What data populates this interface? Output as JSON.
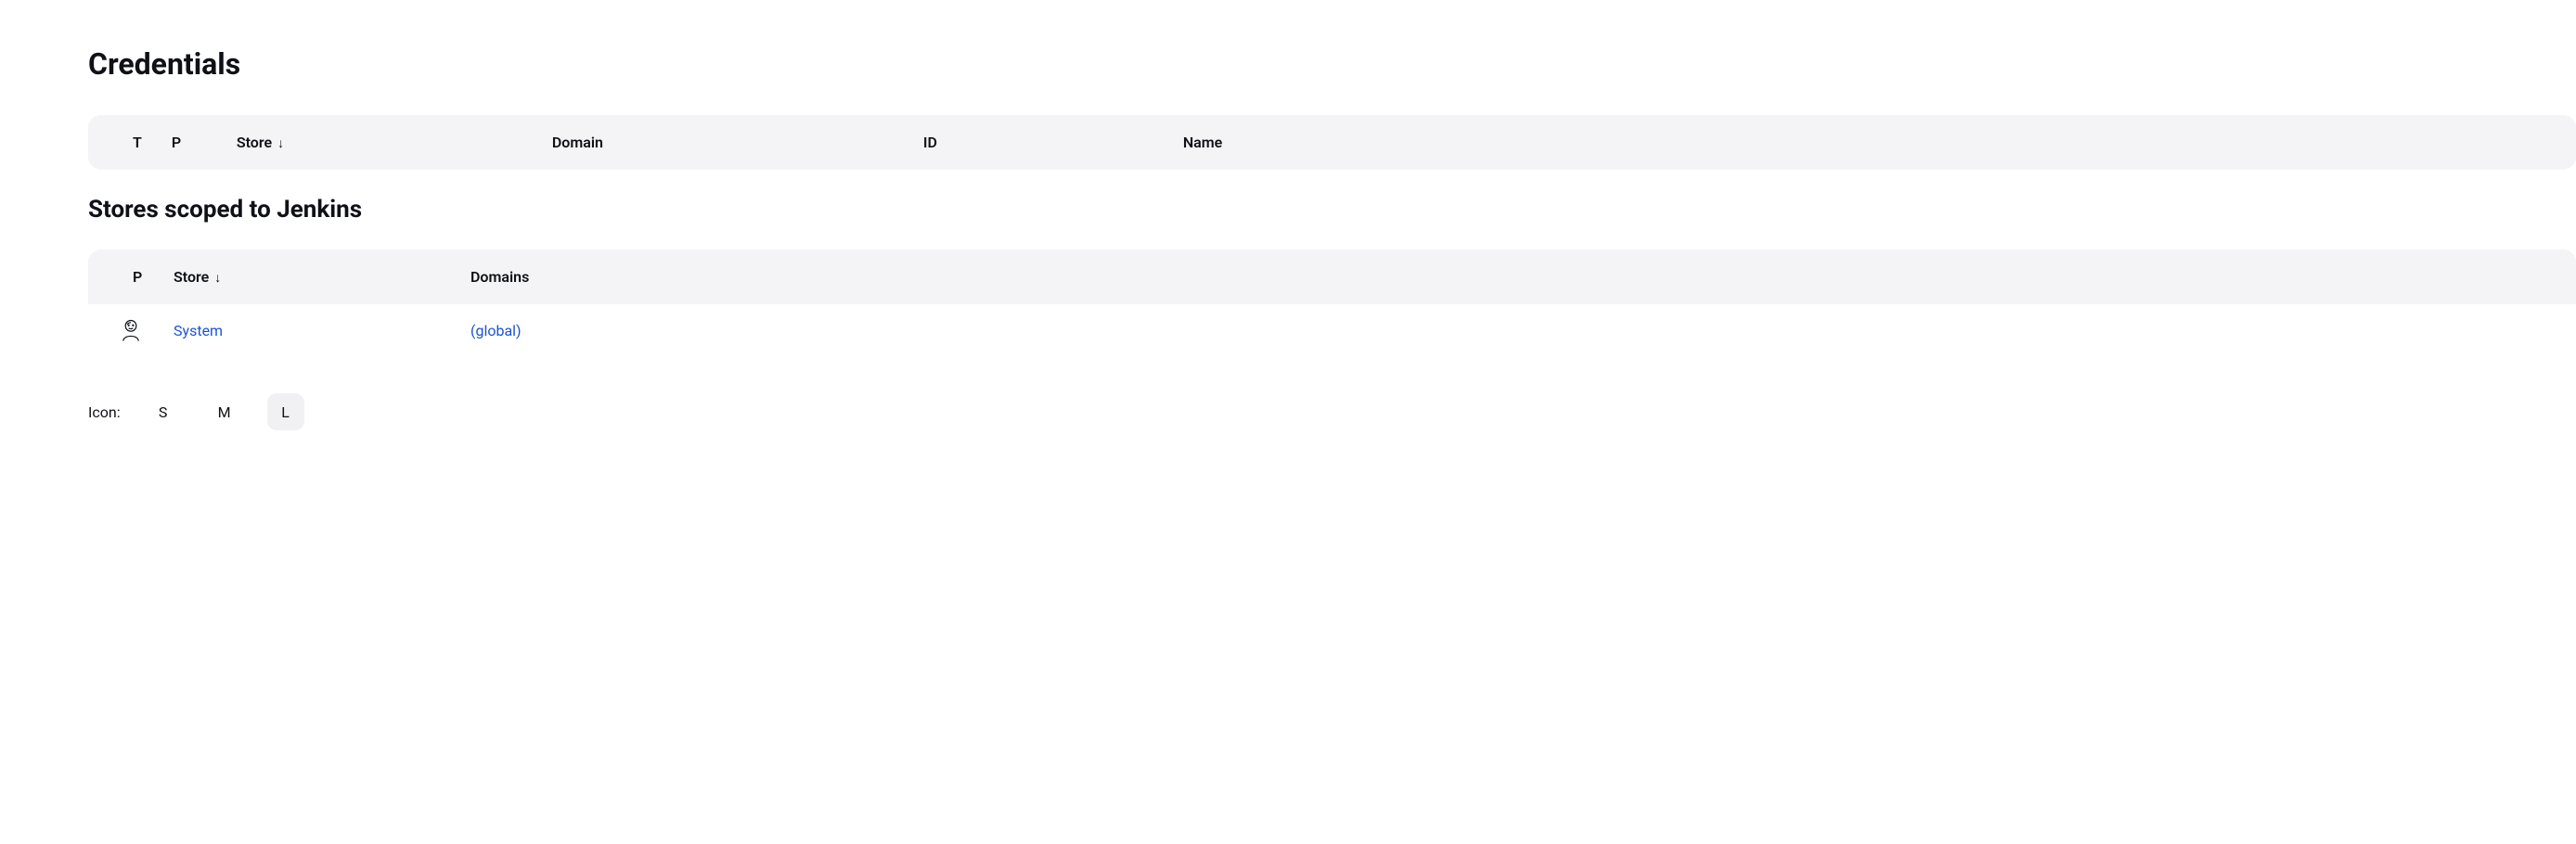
{
  "headings": {
    "title": "Credentials",
    "stores_title": "Stores scoped to Jenkins"
  },
  "credentials_table": {
    "headers": {
      "t": "T",
      "p": "P",
      "store": "Store",
      "domain": "Domain",
      "id": "ID",
      "name": "Name"
    },
    "sort_indicator": "↓"
  },
  "stores_table": {
    "headers": {
      "p": "P",
      "store": "Store",
      "domains": "Domains"
    },
    "sort_indicator": "↓",
    "rows": [
      {
        "store_label": "System",
        "domain_label": "(global)"
      }
    ]
  },
  "icon_size": {
    "label": "Icon:",
    "options": {
      "s": "S",
      "m": "M",
      "l": "L"
    },
    "selected": "L"
  }
}
